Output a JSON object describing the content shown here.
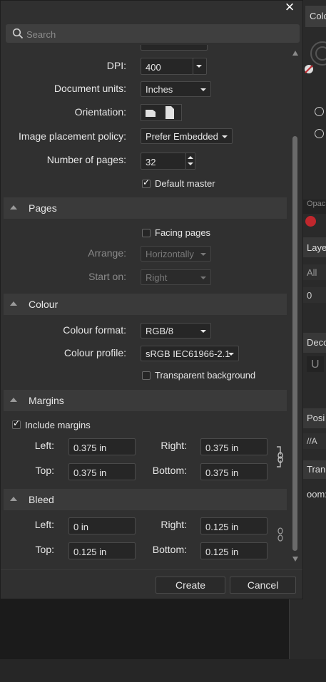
{
  "background_app": {
    "tab_label": "Colo",
    "sections": [
      "Laye",
      "All",
      "0",
      "Deco",
      "U",
      "Posi",
      "Tran",
      "oom:"
    ],
    "faded": [
      "Opaci"
    ]
  },
  "dialog": {
    "close_label": "×",
    "search": {
      "placeholder": "Search",
      "value": ""
    },
    "document": {
      "dpi": {
        "label": "DPI:",
        "value": "400"
      },
      "units": {
        "label": "Document units:",
        "value": "Inches"
      },
      "orientation": {
        "label": "Orientation:"
      },
      "placement": {
        "label": "Image placement policy:",
        "value": "Prefer Embedded"
      },
      "pages_count": {
        "label": "Number of pages:",
        "value": "32"
      },
      "default_master": {
        "label": "Default master",
        "checked": true
      }
    },
    "pages": {
      "title": "Pages",
      "facing": {
        "label": "Facing pages",
        "checked": false
      },
      "arrange": {
        "label": "Arrange:",
        "value": "Horizontally"
      },
      "start_on": {
        "label": "Start on:",
        "value": "Right"
      }
    },
    "colour": {
      "title": "Colour",
      "format": {
        "label": "Colour format:",
        "value": "RGB/8"
      },
      "profile": {
        "label": "Colour profile:",
        "value": "sRGB IEC61966-2.1"
      },
      "transparent": {
        "label": "Transparent background",
        "checked": false
      }
    },
    "margins": {
      "title": "Margins",
      "include": {
        "label": "Include margins",
        "checked": true
      },
      "left": {
        "label": "Left:",
        "value": "0.375 in"
      },
      "right": {
        "label": "Right:",
        "value": "0.375 in"
      },
      "top": {
        "label": "Top:",
        "value": "0.375 in"
      },
      "bottom": {
        "label": "Bottom:",
        "value": "0.375 in"
      }
    },
    "bleed": {
      "title": "Bleed",
      "left": {
        "label": "Left:",
        "value": "0 in"
      },
      "right": {
        "label": "Right:",
        "value": "0.125 in"
      },
      "top": {
        "label": "Top:",
        "value": "0.125 in"
      },
      "bottom": {
        "label": "Bottom:",
        "value": "0.125 in"
      }
    },
    "buttons": {
      "create": "Create",
      "cancel": "Cancel"
    }
  },
  "colors": {
    "dialog_bg": "#303030",
    "section_bg": "#3a3a3a",
    "field_bg": "#262626",
    "accent_red": "#c0272d"
  }
}
